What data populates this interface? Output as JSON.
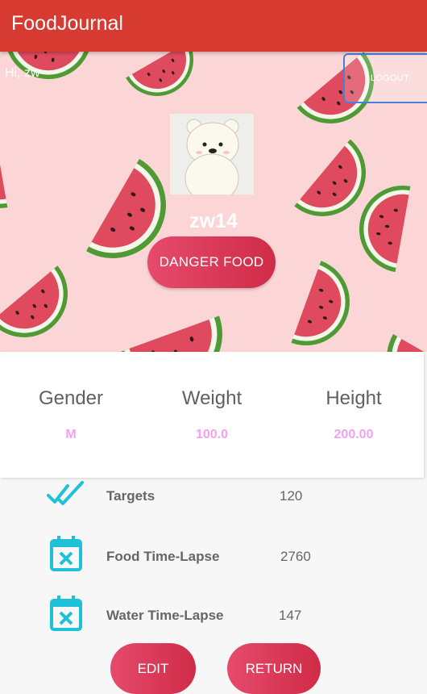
{
  "app": {
    "title": "FoodJournal"
  },
  "header": {
    "greeting": "Hi, zw",
    "logout_label": "LOGOUT",
    "username": "zw14",
    "danger_food_label": "DANGER FOOD"
  },
  "stats": [
    {
      "label": "Gender",
      "value": "M"
    },
    {
      "label": "Weight",
      "value": "100.0"
    },
    {
      "label": "Height",
      "value": "200.00"
    }
  ],
  "list": [
    {
      "icon": "double-check-icon",
      "label": "Targets",
      "value": "120"
    },
    {
      "icon": "calendar-x-icon",
      "label": "Food Time-Lapse",
      "value": "2760"
    },
    {
      "icon": "calendar-x-icon",
      "label": "Water Time-Lapse",
      "value": "147"
    }
  ],
  "actions": {
    "edit_label": "EDIT",
    "return_label": "RETURN"
  },
  "colors": {
    "appbar": "#d63a30",
    "button_accent": "#d9365a",
    "stat_value": "#f2a0f0",
    "icon_accent": "#1ec1d8",
    "hero_bg": "#fcd6d6"
  }
}
